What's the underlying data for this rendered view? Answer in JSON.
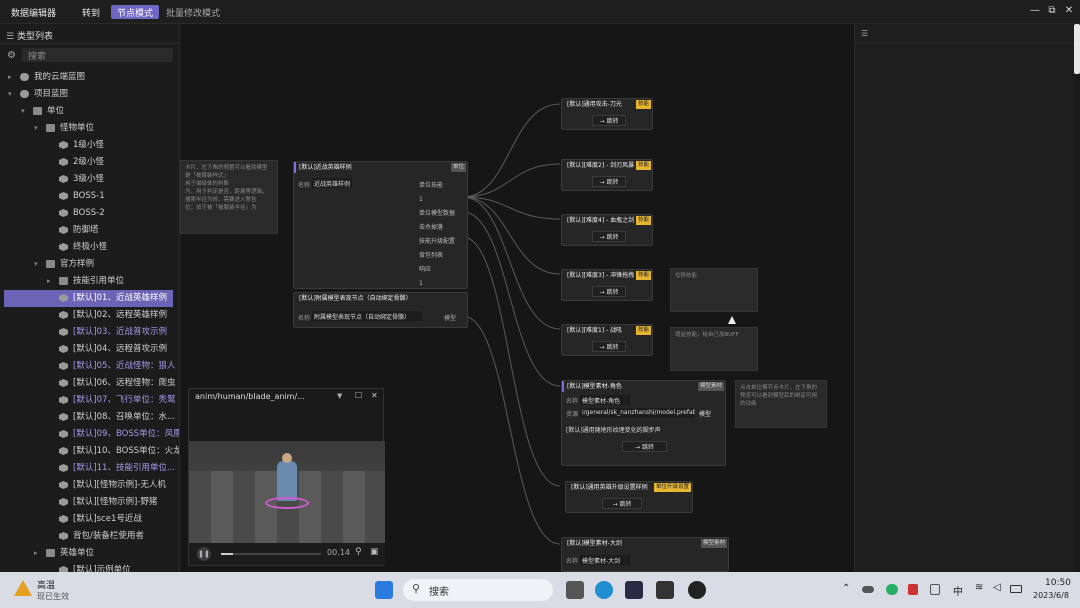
{
  "titlebar": {
    "app_title": "数据编辑器",
    "goto_label": "转到",
    "mode_node": "节点模式",
    "mode_batch": "批量修改模式",
    "minimize": "—",
    "restore": "⧉",
    "close": "✕"
  },
  "left_panel": {
    "header": "类型列表",
    "search_placeholder": "搜索",
    "tree": [
      {
        "label": "我的云端蓝图",
        "icon": "cloud",
        "level": 1,
        "caret": "▸"
      },
      {
        "label": "项目蓝图",
        "icon": "cloud",
        "level": 1,
        "caret": "▾"
      },
      {
        "label": "单位",
        "icon": "folder",
        "level": 2,
        "caret": "▾"
      },
      {
        "label": "怪物单位",
        "icon": "folder",
        "level": 3,
        "caret": "▾"
      },
      {
        "label": "1级小怪",
        "icon": "cube",
        "level": 4
      },
      {
        "label": "2级小怪",
        "icon": "cube",
        "level": 4
      },
      {
        "label": "3级小怪",
        "icon": "cube",
        "level": 4
      },
      {
        "label": "BOSS-1",
        "icon": "cube",
        "level": 4
      },
      {
        "label": "BOSS-2",
        "icon": "cube",
        "level": 4
      },
      {
        "label": "防御塔",
        "icon": "cube",
        "level": 4
      },
      {
        "label": "终极小怪",
        "icon": "cube",
        "level": 4
      },
      {
        "label": "官方样例",
        "icon": "folder",
        "level": 3,
        "caret": "▾"
      },
      {
        "label": "技能引用单位",
        "icon": "folder",
        "level": 4,
        "caret": "▸"
      },
      {
        "label": "[默认]01、近战英雄样例",
        "icon": "cube",
        "level": 4,
        "selected": true
      },
      {
        "label": "[默认]02、远程英雄样例",
        "icon": "cube",
        "level": 4
      },
      {
        "label": "[默认]03、近战普攻示例",
        "icon": "cube",
        "level": 4
      },
      {
        "label": "[默认]04、远程普攻示例",
        "icon": "cube",
        "level": 4
      },
      {
        "label": "[默认]05、近战怪物：狼人",
        "icon": "cube",
        "level": 4
      },
      {
        "label": "[默认]06、远程怪物：爬虫",
        "icon": "cube",
        "level": 4
      },
      {
        "label": "[默认]07、飞行单位：秃鹫",
        "icon": "cube",
        "level": 4
      },
      {
        "label": "[默认]08、召唤单位：水...",
        "icon": "cube",
        "level": 4
      },
      {
        "label": "[默认]09、BOSS单位：凤凰",
        "icon": "cube",
        "level": 4
      },
      {
        "label": "[默认]10、BOSS单位：火龙",
        "icon": "cube",
        "level": 4
      },
      {
        "label": "[默认]11、技能引用单位...",
        "icon": "cube",
        "level": 4
      },
      {
        "label": "[默认][怪物示例]-无人机",
        "icon": "cube",
        "level": 4
      },
      {
        "label": "[默认][怪物示例]-野猪",
        "icon": "cube",
        "level": 4
      },
      {
        "label": "[默认]sce1号近战",
        "icon": "cube",
        "level": 4
      },
      {
        "label": "背包/装备栏使用者",
        "icon": "cube",
        "level": 4
      },
      {
        "label": "英雄单位",
        "icon": "folder",
        "level": 3,
        "caret": "▸"
      },
      {
        "label": "[默认]示例单位",
        "icon": "cube",
        "level": 4
      }
    ]
  },
  "canvas": {
    "left_note": [
      "卡片，左下角的预置可以看到模型",
      "是「被服装样式」",
      "用于描绘体的判断",
      "为，用于判定是否，距离等逻辑，",
      "搜索半径为时，需要进入警告",
      "位；如于被「被服装半径」为"
    ],
    "main_node": {
      "title": "[默认]近战英雄样例",
      "tag": "单位",
      "name_label": "名称",
      "name_value": "近战英雄样例",
      "ports": [
        "单位技能",
        "1",
        "单位模型数据",
        "击杀掉落",
        "技能升级配置",
        "背包列表",
        "响应",
        "1"
      ]
    },
    "sub_node": {
      "title": "[默认]附属模型表现节点（自动绑定骨骼）",
      "name_label": "名称",
      "name_value": "附属模型表现节点（自动绑定骨骼）",
      "port": "模型"
    },
    "skill_nodes": [
      {
        "title": "[默认]通用攻击-刀光",
        "tag": "技能",
        "jump": "跳转"
      },
      {
        "title": "[默认][难度2] - 剑刃风暴",
        "tag": "技能",
        "jump": "跳转"
      },
      {
        "title": "[默认][难度4] - 血瓶之剑",
        "tag": "技能",
        "jump": "跳转"
      },
      {
        "title": "[默认][难度3] - 冲锋拖拽",
        "tag": "技能",
        "jump": "跳转"
      },
      {
        "title": "[默认][难度1] - 战吼",
        "tag": "技能",
        "jump": "跳转"
      }
    ],
    "notes": [
      {
        "text": "位移技能"
      },
      {
        "text": "增益技能，给自己加BUFF"
      }
    ],
    "model_node": {
      "title": "[默认]模型素材-角色",
      "tag": "模型素材",
      "name_label": "名称",
      "name_value": "模型素材-角色",
      "res_label": "资源",
      "res_value": "i/general/sk_nanzhanshi/model.prefab",
      "res_tag": "模型",
      "sub_title": "[默认]通用随地形纹理变化的脚步声",
      "jump": "跳转"
    },
    "model_note": "点击单位模节点卡片，左下角的预览可以看到模型后的绑定可用的动画",
    "upgrade_node": {
      "title": "[默认]通用英雄升级设置样例",
      "tag": "单位升级设置",
      "jump": "跳转"
    },
    "sword_node": {
      "title": "[默认]模型素材-大剑",
      "tag": "模型素材",
      "name_label": "名称",
      "name_value": "模型素材-大剑"
    }
  },
  "player": {
    "title": "anim/human/blade_anim/...",
    "time": "00.14",
    "progress": 0.12
  },
  "taskbar": {
    "weather_title": "高温",
    "weather_sub": "现已生效",
    "search_label": "搜索",
    "ime": "中",
    "time": "10:50",
    "date": "2023/6/8"
  }
}
